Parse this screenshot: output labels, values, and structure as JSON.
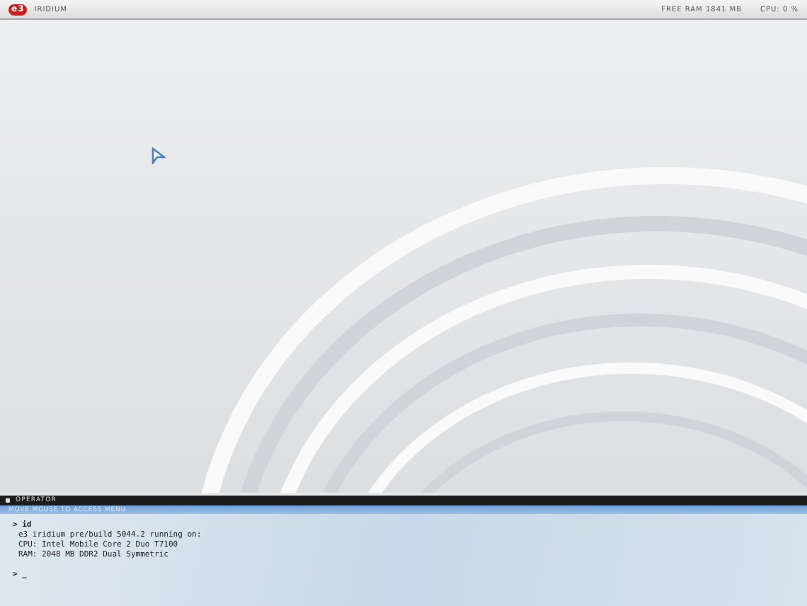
{
  "top_bar": {
    "logo": "e3",
    "title": "IRIDIUM",
    "free_ram": "FREE RAM 1841 MB",
    "cpu": "CPU: 0 %"
  },
  "console": {
    "title": "OPERATOR",
    "hint": "MOVE MOUSE TO ACCESS MENU",
    "lines": [
      {
        "kind": "command",
        "text": "> id"
      },
      {
        "kind": "output",
        "text": "e3 iridium pre/build 5044.2 running on:"
      },
      {
        "kind": "output",
        "text": "CPU: Intel Mobile Core 2 Duo T7100"
      },
      {
        "kind": "output",
        "text": "RAM: 2048 MB DDR2 Dual Symmetric"
      },
      {
        "kind": "blank"
      },
      {
        "kind": "prompt",
        "text": "> _"
      }
    ]
  }
}
